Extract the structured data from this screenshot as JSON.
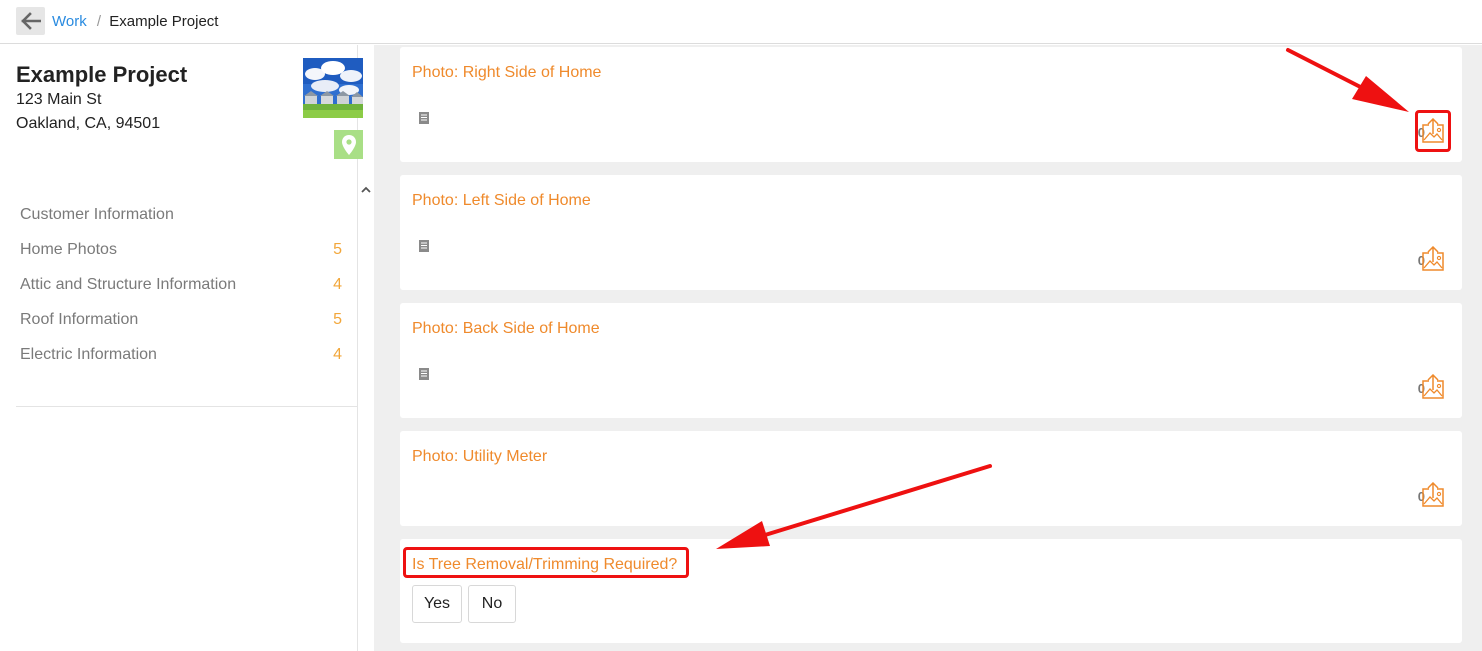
{
  "breadcrumb": {
    "parent": "Work",
    "separator": "/",
    "current": "Example Project"
  },
  "project": {
    "title": "Example Project",
    "address_line1": "123 Main St",
    "address_line2": "Oakland, CA, 94501"
  },
  "sidebar": {
    "items": [
      {
        "label": "Customer Information",
        "count": ""
      },
      {
        "label": "Home Photos",
        "count": "5"
      },
      {
        "label": "Attic and Structure Information",
        "count": "4"
      },
      {
        "label": "Roof Information",
        "count": "5"
      },
      {
        "label": "Electric Information",
        "count": "4"
      }
    ]
  },
  "cards": [
    {
      "title": "Photo: Right Side of Home",
      "photo_count": "0"
    },
    {
      "title": "Photo: Left Side of Home",
      "photo_count": "0"
    },
    {
      "title": "Photo: Back Side of Home",
      "photo_count": "0"
    },
    {
      "title": "Photo: Utility Meter",
      "photo_count": "0"
    }
  ],
  "question": {
    "title": "Is Tree Removal/Trimming Required?",
    "yes_label": "Yes",
    "no_label": "No"
  },
  "icons": {
    "back": "arrow-left-icon",
    "map": "map-pin-icon",
    "note": "note-icon",
    "upload": "image-upload-icon"
  },
  "colors": {
    "accent_orange": "#ef8a2c",
    "count_orange": "#f2a73b",
    "link_blue": "#2a8be0",
    "map_green": "#a9df86",
    "annotation_red": "#ee1111"
  }
}
